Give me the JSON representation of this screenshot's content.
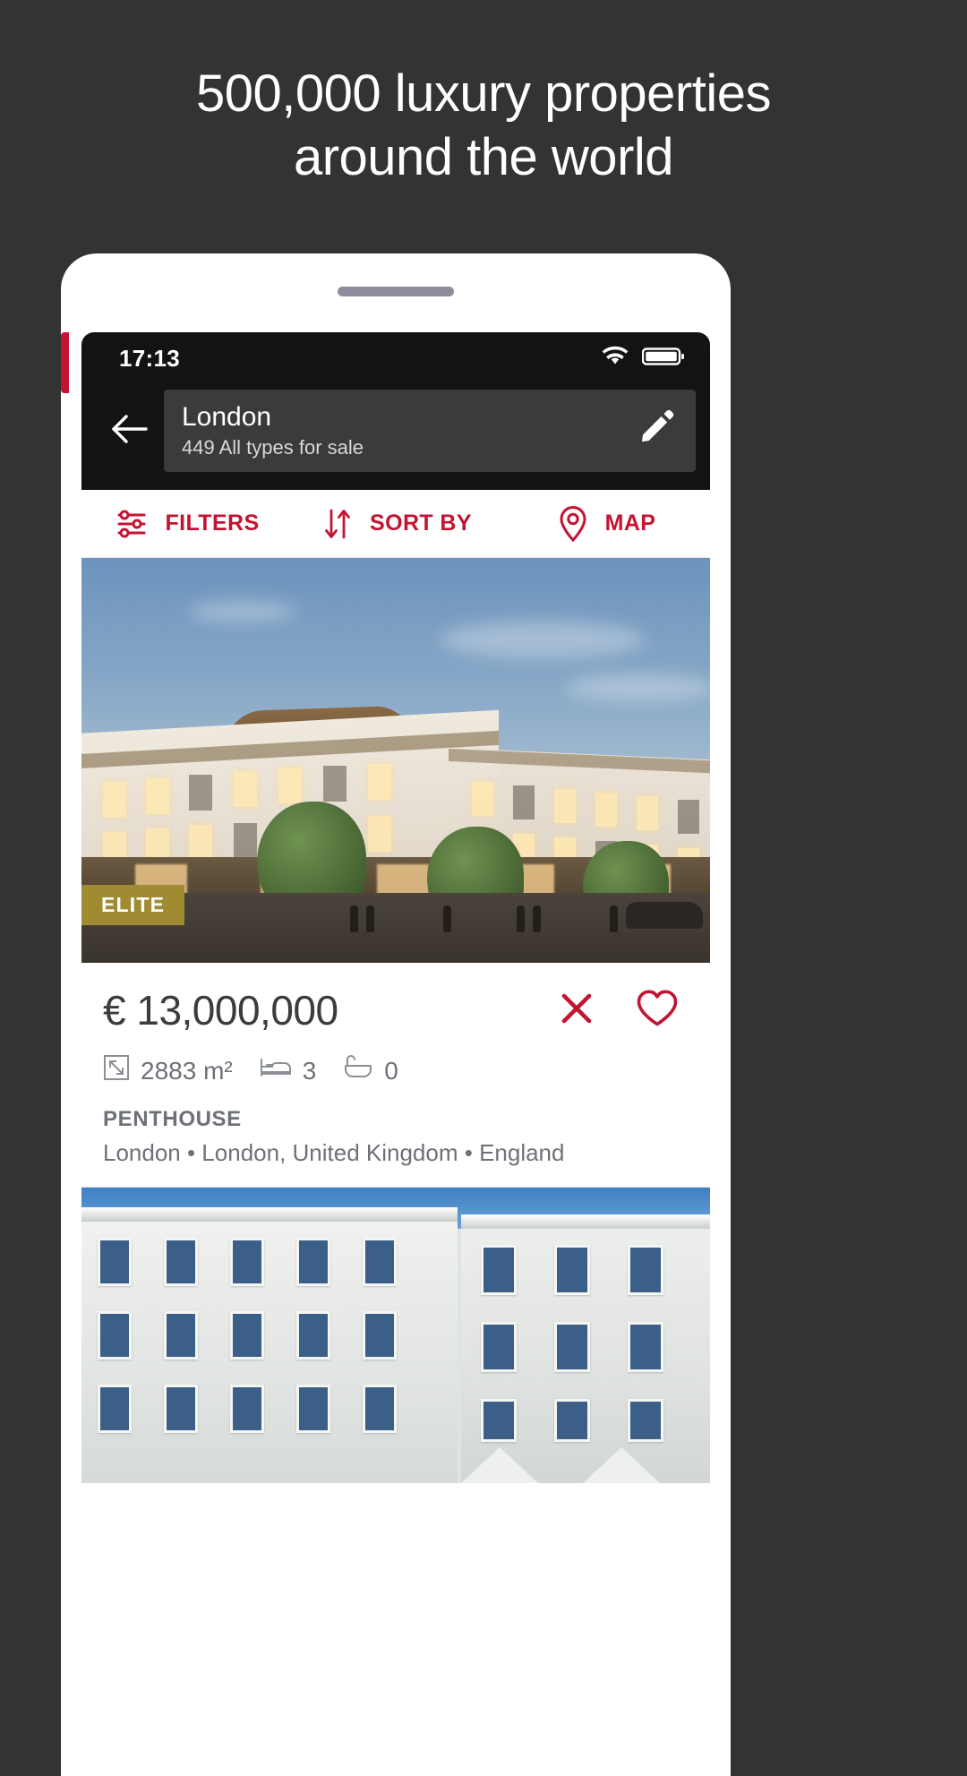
{
  "headline": {
    "line1": "500,000 luxury properties",
    "line2": "around the world"
  },
  "phone": {
    "statusbar": {
      "time": "17:13",
      "wifi_icon": "wifi-icon",
      "battery_icon": "battery-icon"
    },
    "header": {
      "back_icon": "back-arrow-icon",
      "search_title": "London",
      "search_subtitle": "449 All types for sale",
      "edit_icon": "pencil-icon"
    },
    "toolbar": {
      "accent_color": "#c31432",
      "items": [
        {
          "label": "FILTERS",
          "icon": "sliders-icon"
        },
        {
          "label": "SORT BY",
          "icon": "sort-arrows-icon"
        },
        {
          "label": "MAP",
          "icon": "map-pin-icon"
        }
      ]
    },
    "listing": {
      "badge": "ELITE",
      "badge_color": "#a08b33",
      "price": "€ 13,000,000",
      "close_icon": "close-x-icon",
      "favorite_icon": "heart-icon",
      "specs": [
        {
          "icon": "area-icon",
          "value": "2883 m²"
        },
        {
          "icon": "bed-icon",
          "value": "3"
        },
        {
          "icon": "bath-icon",
          "value": "0"
        }
      ],
      "property_type": "PENTHOUSE",
      "location": "London • London, United Kingdom • England"
    }
  }
}
